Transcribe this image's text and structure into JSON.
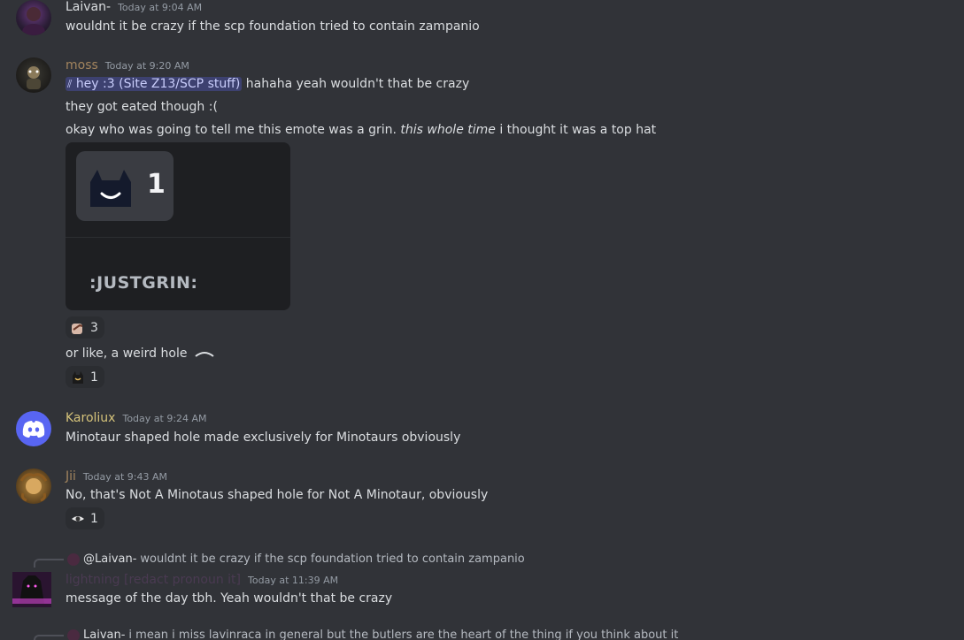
{
  "messages": {
    "m1": {
      "user": "Laivan-",
      "time": "Today at 9:04 AM",
      "text": "wouldnt it be crazy if the scp foundation tried to contain zampanio"
    },
    "m2": {
      "user": "moss",
      "time": "Today at 9:20 AM",
      "mention": "hey :3 (Site Z13/SCP stuff)",
      "line1_rest": " hahaha yeah wouldn't that be crazy",
      "line2": "they got eated though :(",
      "line3_pre": "okay who was going to tell me this emote was a grin. ",
      "line3_em": "this whole time",
      "line3_post": " i thought it was a top hat",
      "embed": {
        "count": "1",
        "emote_name": ":JUSTGRIN:"
      },
      "reaction1_count": "3",
      "line4": "or like, a weird hole",
      "reaction2_count": "1"
    },
    "m3": {
      "user": "Karoliux",
      "time": "Today at 9:24 AM",
      "text": "Minotaur shaped hole made exclusively for Minotaurs obviously"
    },
    "m4": {
      "user": "Jii",
      "time": "Today at 9:43 AM",
      "text": "No, that's Not A Minotaus shaped hole for Not A Minotaur, obviously",
      "reaction_count": "1"
    },
    "m5": {
      "reply_user": "@Laivan-",
      "reply_text": "wouldnt it be crazy if the scp foundation tried to contain zampanio",
      "user": "lightning [redact pronoun it]",
      "time": "Today at 11:39 AM",
      "text": "message of the day tbh. Yeah wouldn't that be crazy"
    },
    "m6": {
      "reply_user": "Laivan-",
      "reply_text": "i mean i miss lavinraca in general but the butlers are the heart of the thing if you think about it"
    }
  },
  "colors": {
    "background": "#313338",
    "laivan": "#dbdee1",
    "moss": "#a2845e",
    "karoliux": "#d4c27a",
    "jii": "#a2845e",
    "lightning": "#4a3a52",
    "mention_bg": "#5865f2",
    "discord_blurple": "#5865f2"
  }
}
